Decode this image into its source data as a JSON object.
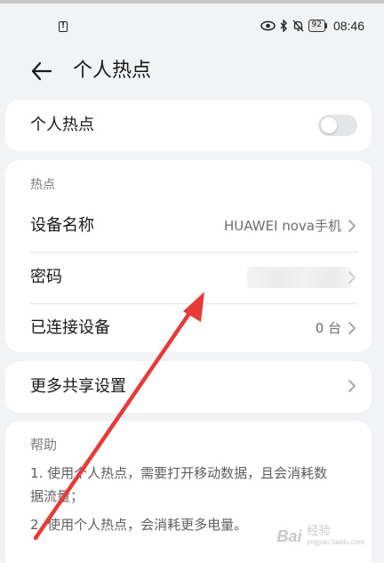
{
  "status_bar": {
    "time": "08:46",
    "battery_level": "92",
    "icons": [
      "alert-icon",
      "eye-icon",
      "bluetooth-icon",
      "bell-off-icon",
      "battery-icon"
    ]
  },
  "header": {
    "title": "个人热点",
    "back_icon": "arrow-left-icon"
  },
  "hotspot_card": {
    "label": "个人热点",
    "toggle_on": false
  },
  "settings_card": {
    "section_label": "热点",
    "device_name": {
      "label": "设备名称",
      "value": "HUAWEI nova手机"
    },
    "password": {
      "label": "密码"
    },
    "connected_devices": {
      "label": "已连接设备",
      "value": "0 台"
    }
  },
  "more_card": {
    "label": "更多共享设置"
  },
  "help_card": {
    "title": "帮助",
    "lines": [
      "1. 使用个人热点，需要打开移动数据，且会消耗数",
      "据流量；",
      "2. 使用个人热点，会消耗更多电量。"
    ]
  },
  "annotation": {
    "color": "#e83a3a"
  },
  "watermark": {
    "brand": "Bai",
    "text": "经验",
    "sub": "jingyan.baidu.com"
  },
  "colors": {
    "background": "#f1f3f5",
    "card": "#ffffff",
    "toggle_off": "#e4e5e7",
    "secondary_text": "#6e6e6e"
  }
}
